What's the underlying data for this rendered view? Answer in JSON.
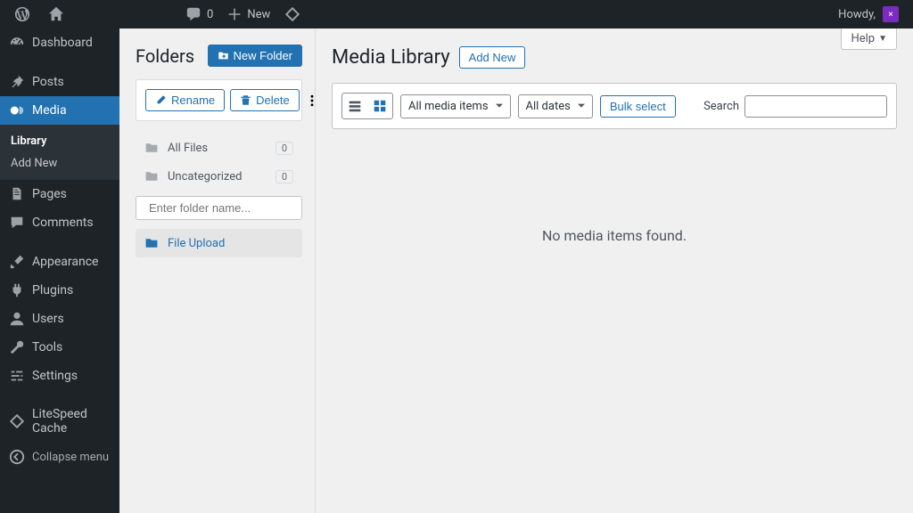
{
  "adminbar": {
    "comments_count": "0",
    "new_label": "New",
    "howdy": "Howdy,"
  },
  "sidebar": {
    "items": [
      {
        "label": "Dashboard"
      },
      {
        "label": "Posts"
      },
      {
        "label": "Media"
      },
      {
        "label": "Pages"
      },
      {
        "label": "Comments"
      },
      {
        "label": "Appearance"
      },
      {
        "label": "Plugins"
      },
      {
        "label": "Users"
      },
      {
        "label": "Tools"
      },
      {
        "label": "Settings"
      },
      {
        "label": "LiteSpeed Cache"
      }
    ],
    "submenu": {
      "library": "Library",
      "addnew": "Add New"
    },
    "collapse": "Collapse menu"
  },
  "folders": {
    "title": "Folders",
    "new_folder": "New Folder",
    "rename": "Rename",
    "delete": "Delete",
    "all_files": {
      "label": "All Files",
      "count": "0"
    },
    "uncategorized": {
      "label": "Uncategorized",
      "count": "0"
    },
    "search_placeholder": "Enter folder name...",
    "selected": {
      "label": "File Upload"
    }
  },
  "main": {
    "help": "Help",
    "title": "Media Library",
    "add_new": "Add New",
    "filter_media": "All media items",
    "filter_dates": "All dates",
    "bulk_select": "Bulk select",
    "search_label": "Search",
    "empty": "No media items found."
  }
}
